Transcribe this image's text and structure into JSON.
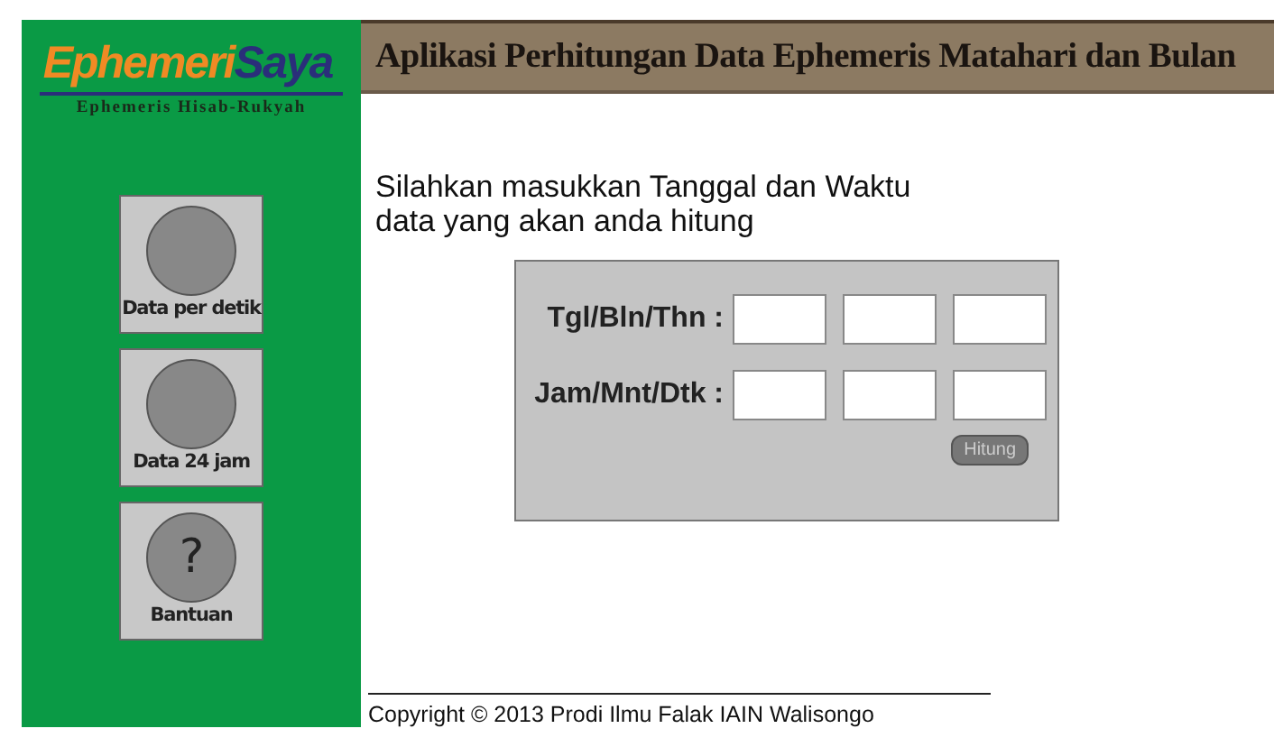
{
  "logo": {
    "part_1": "Ephemeri",
    "part_2": "Saya",
    "subtitle": "Ephemeris Hisab-Rukyah"
  },
  "header": {
    "title": "Aplikasi Perhitungan Data Ephemeris Matahari dan Bulan"
  },
  "menu": [
    {
      "label": "Data per detik",
      "kind": "plain"
    },
    {
      "label": "Data 24 jam",
      "kind": "plain"
    },
    {
      "label": "Bantuan",
      "kind": "help",
      "symbol": "?"
    }
  ],
  "instruction": {
    "line_1": "Silahkan masukkan Tanggal dan Waktu",
    "line_2": "data yang akan anda hitung"
  },
  "form": {
    "rows": [
      {
        "label": "Tgl/Bln/Thn :"
      },
      {
        "label": "Jam/Mnt/Dtk :"
      }
    ],
    "button": "Hitung"
  },
  "footer": {
    "copyright": "Copyright © 2013 Prodi Ilmu Falak IAIN Walisongo"
  }
}
